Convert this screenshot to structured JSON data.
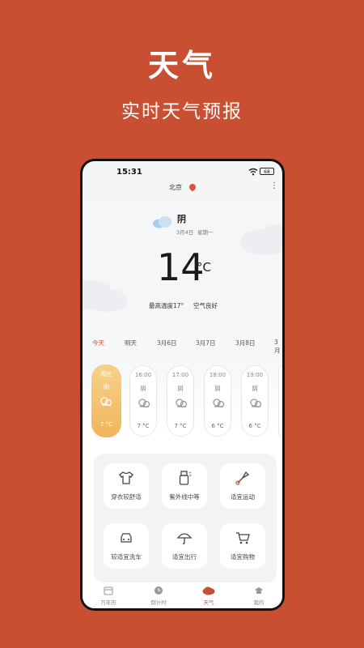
{
  "promo": {
    "title": "天气",
    "subtitle": "实时天气预报"
  },
  "status_bar": {
    "time": "15:31",
    "battery": "68"
  },
  "header": {
    "city": "北京"
  },
  "current": {
    "condition": "阴",
    "date": "3月4日",
    "weekday": "星期一",
    "temperature": "14",
    "unit": "°C",
    "high": "最高温度17°",
    "air_quality": "空气良好"
  },
  "day_tabs": [
    "今天",
    "明天",
    "3月6日",
    "3月7日",
    "3月8日",
    "3月"
  ],
  "hourly": [
    {
      "time": "现在",
      "condition": "阴",
      "temp": "7 °C",
      "active": true
    },
    {
      "time": "16:00",
      "condition": "阴",
      "temp": "7 °C"
    },
    {
      "time": "17:00",
      "condition": "阴",
      "temp": "7 °C"
    },
    {
      "time": "18:00",
      "condition": "阴",
      "temp": "6 °C"
    },
    {
      "time": "19:00",
      "condition": "阴",
      "temp": "6 °C"
    }
  ],
  "tips": [
    {
      "label": "穿衣较舒适",
      "icon": "shirt-icon"
    },
    {
      "label": "紫外线中等",
      "icon": "sunscreen-icon"
    },
    {
      "label": "适宜运动",
      "icon": "badminton-icon"
    },
    {
      "label": "较适宜洗车",
      "icon": "car-wash-icon"
    },
    {
      "label": "适宜出行",
      "icon": "umbrella-icon"
    },
    {
      "label": "适宜购物",
      "icon": "shopping-cart-icon"
    }
  ],
  "nav": [
    {
      "label": "万年历",
      "icon": "calendar-icon"
    },
    {
      "label": "倒计时",
      "icon": "clock-icon"
    },
    {
      "label": "天气",
      "icon": "weather-icon",
      "active": true
    },
    {
      "label": "我的",
      "icon": "profile-icon"
    }
  ],
  "colors": {
    "brand": "#C84F31",
    "active_hour": "#F0B55A"
  }
}
